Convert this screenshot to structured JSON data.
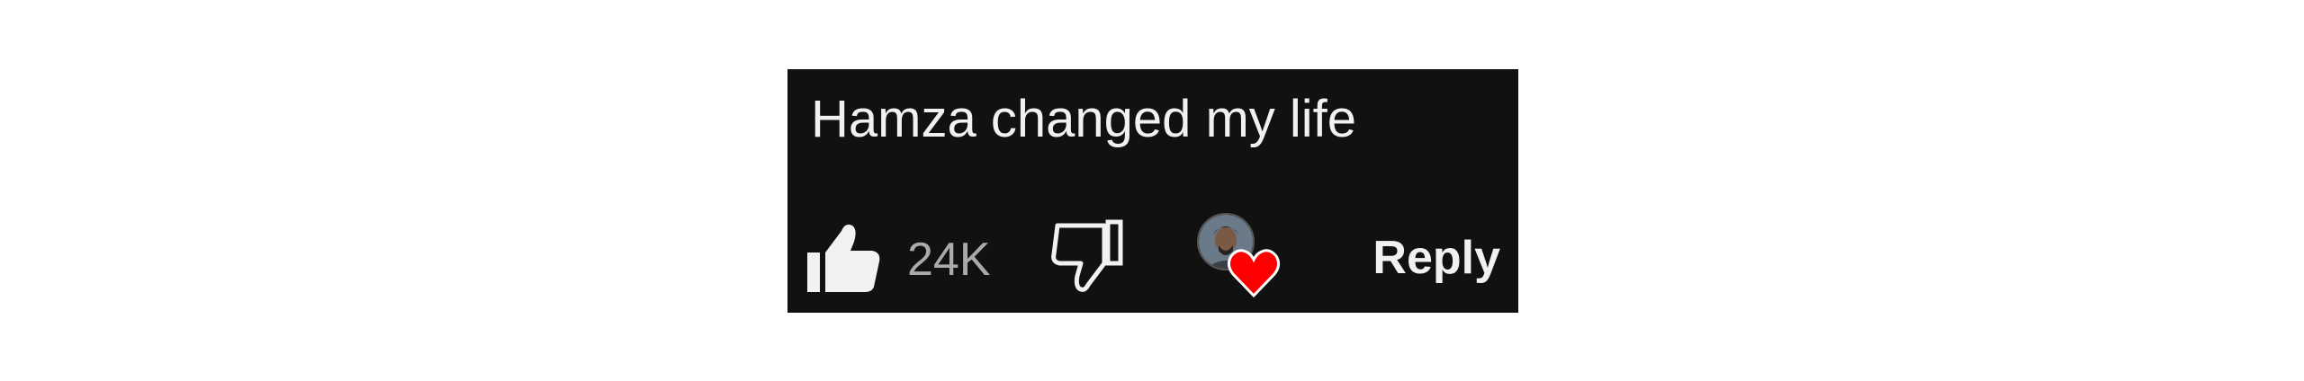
{
  "comment": {
    "text": "Hamza changed my life"
  },
  "actions": {
    "like_count": "24K",
    "like_icon": "thumbs-up-icon",
    "dislike_icon": "thumbs-down-icon",
    "creator_heart_icon": "heart-icon",
    "reply_label": "Reply"
  },
  "colors": {
    "card_background": "#111111",
    "text": "#f1f1f1",
    "count": "#aaaaaa",
    "heart": "#ff0000"
  }
}
